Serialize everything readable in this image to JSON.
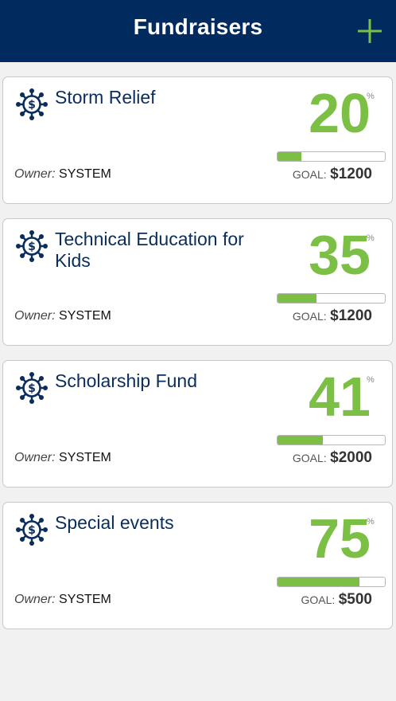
{
  "header": {
    "title": "Fundraisers",
    "add_icon": "plus-icon",
    "accent_color": "#7bbf44",
    "background_color": "#012a5e"
  },
  "fundraisers": [
    {
      "title": "Storm Relief",
      "percent": "20",
      "percent_sign": "%",
      "progress_fraction": 0.22,
      "owner_label": "Owner:",
      "owner": "SYSTEM",
      "goal_label": "GOAL:",
      "goal_amount": "$1200",
      "icon": "donation-network-icon"
    },
    {
      "title": "Technical Education for Kids",
      "percent": "35",
      "percent_sign": "%",
      "progress_fraction": 0.36,
      "owner_label": "Owner:",
      "owner": "SYSTEM",
      "goal_label": "GOAL:",
      "goal_amount": "$1200",
      "icon": "donation-network-icon"
    },
    {
      "title": "Scholarship Fund",
      "percent": "41",
      "percent_sign": "%",
      "progress_fraction": 0.42,
      "owner_label": "Owner:",
      "owner": "SYSTEM",
      "goal_label": "GOAL:",
      "goal_amount": "$2000",
      "icon": "donation-network-icon"
    },
    {
      "title": "Special events",
      "percent": "75",
      "percent_sign": "%",
      "progress_fraction": 0.76,
      "owner_label": "Owner:",
      "owner": "SYSTEM",
      "goal_label": "GOAL:",
      "goal_amount": "$500",
      "icon": "donation-network-icon"
    }
  ]
}
